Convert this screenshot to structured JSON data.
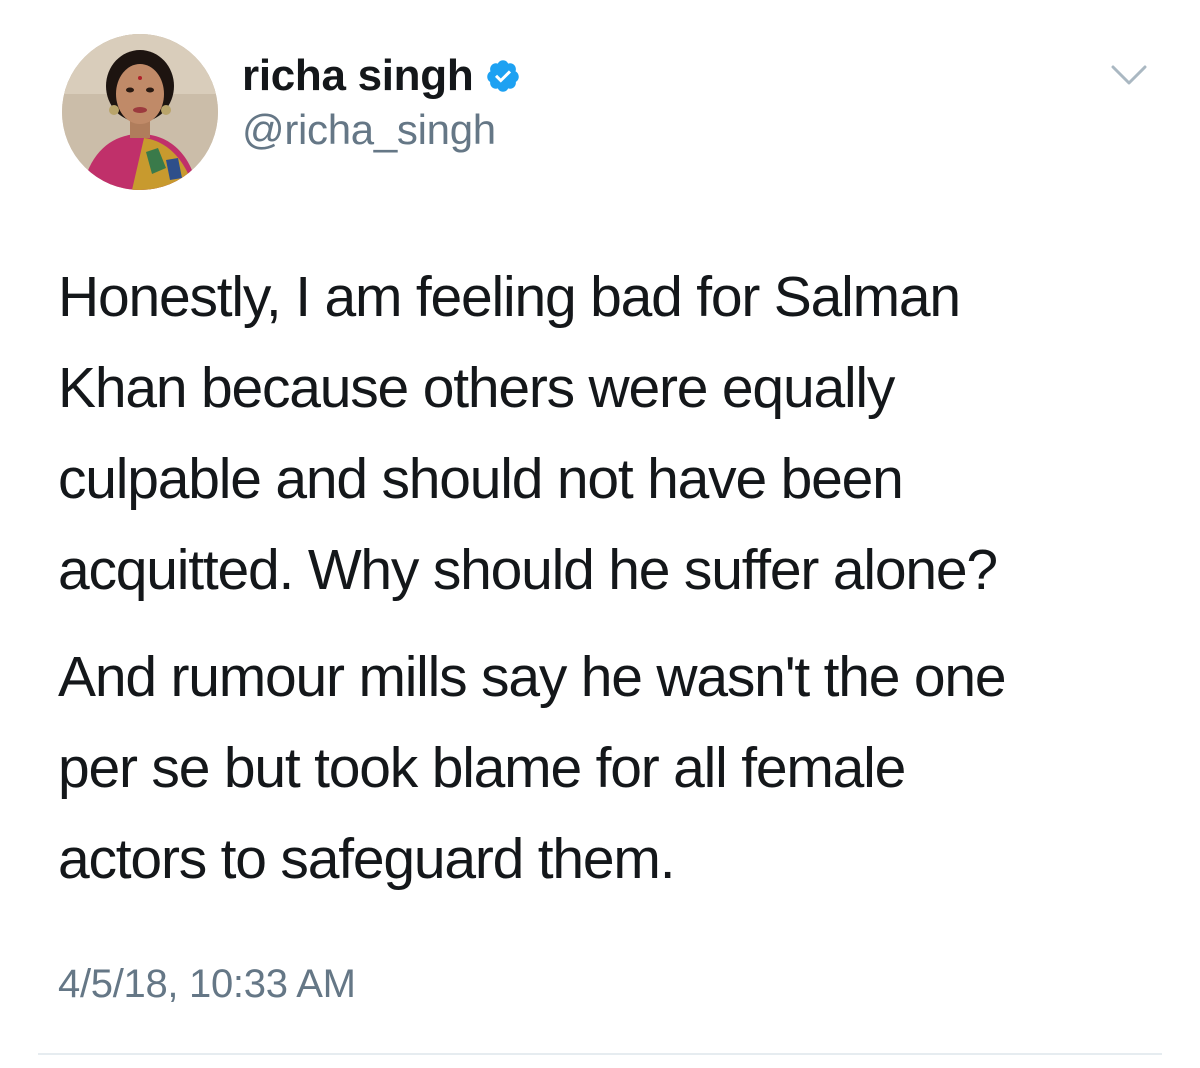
{
  "tweet": {
    "author": {
      "display_name": "richa singh",
      "handle": "@richa_singh",
      "verified": true,
      "avatar_icon": "profile-photo"
    },
    "menu_icon": "chevron-down-icon",
    "paragraphs": [
      {
        "lines": [
          "Honestly, I am feeling bad for Salman",
          "Khan because others were equally",
          "culpable and should not have been",
          "acquitted. Why should he suffer alone?"
        ]
      },
      {
        "lines": [
          "And rumour mills say he wasn't the one",
          "per se but took blame for all female",
          "actors to safeguard them."
        ]
      }
    ],
    "timestamp": "4/5/18, 10:33 AM"
  },
  "colors": {
    "text": "#14171a",
    "secondary": "#657786",
    "verified_blue": "#1da1f2",
    "divider": "#e6ecf0"
  }
}
